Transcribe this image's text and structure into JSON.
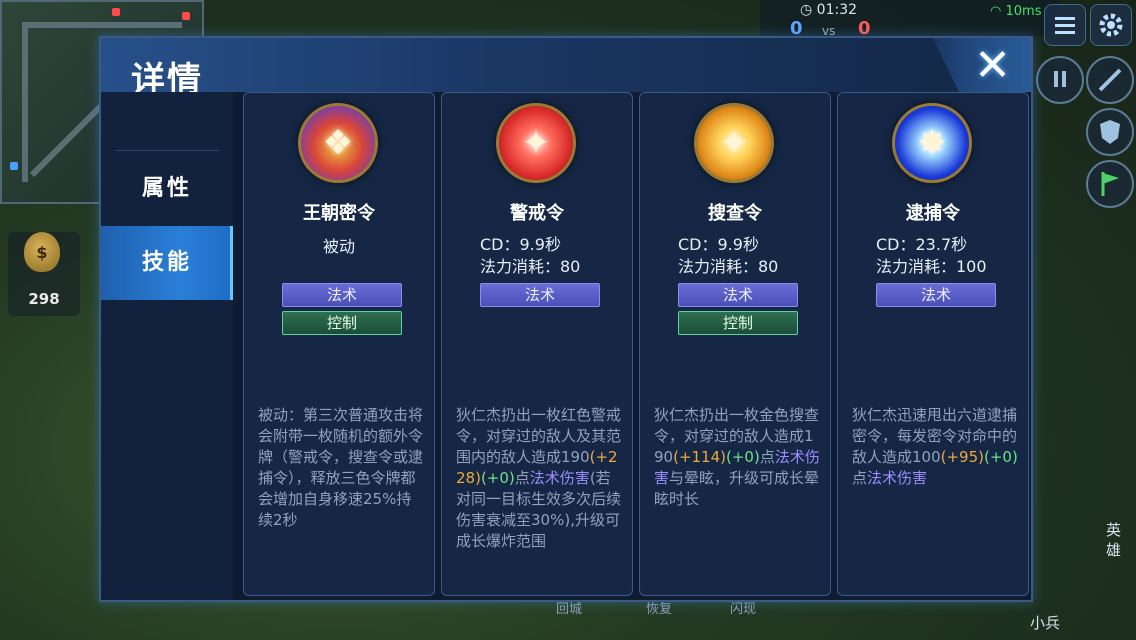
{
  "hud": {
    "timer": "01:32",
    "score_blue": "0",
    "score_vs": "vs",
    "score_red": "0",
    "ping": "10ms",
    "gold": "298",
    "gold_symbol": "$",
    "hero_button_label": "英\n雄",
    "minion_label": "小兵",
    "bottom_labels": [
      "回城",
      "恢复",
      "闪现"
    ]
  },
  "dialog": {
    "title": "详情",
    "close_symbol": "✕",
    "tabs": [
      {
        "label": "属性",
        "active": false
      },
      {
        "label": "技能",
        "active": true
      }
    ]
  },
  "skills": [
    {
      "name": "王朝密令",
      "passive_label": "被动",
      "cd": "",
      "mana": "",
      "tags": [
        "法术",
        "控制"
      ],
      "icon": "dynasty-order-icon",
      "icon_colors": [
        "#6a3fb8",
        "#d8443a",
        "#f0c23c"
      ],
      "desc_parts": [
        {
          "text": "被动：第三次普通攻击将会附带一枚随机的额外令牌（警戒令，搜查令或逮捕令），释放三色令牌都会增加自身移速25%持续2秒",
          "style": "normal"
        }
      ]
    },
    {
      "name": "警戒令",
      "passive_label": "",
      "cd": "CD：9.9秒",
      "mana": "法力消耗：80",
      "tags": [
        "法术"
      ],
      "icon": "alert-order-icon",
      "icon_colors": [
        "#d82a2a",
        "#ff6b5a"
      ],
      "desc_parts": [
        {
          "text": "狄仁杰扔出一枚红色警戒令，对穿过的敌人及其范围内的敌人造成190",
          "style": "normal"
        },
        {
          "text": "(+228)",
          "style": "orange"
        },
        {
          "text": "(+0)",
          "style": "green"
        },
        {
          "text": "点",
          "style": "normal"
        },
        {
          "text": "法术伤害",
          "style": "purple"
        },
        {
          "text": "(若对同一目标生效多次后续伤害衰减至30%),升级可成长爆炸范围",
          "style": "normal"
        }
      ]
    },
    {
      "name": "搜查令",
      "passive_label": "",
      "cd": "CD：9.9秒",
      "mana": "法力消耗：80",
      "tags": [
        "法术",
        "控制"
      ],
      "icon": "search-order-icon",
      "icon_colors": [
        "#e08a1a",
        "#ffd35a"
      ],
      "desc_parts": [
        {
          "text": "狄仁杰扔出一枚金色搜查令，对穿过的敌人造成190",
          "style": "normal"
        },
        {
          "text": "(+114)",
          "style": "orange"
        },
        {
          "text": "(+0)",
          "style": "green"
        },
        {
          "text": "点",
          "style": "normal"
        },
        {
          "text": "法术伤害",
          "style": "purple"
        },
        {
          "text": "与晕眩，升级可成长晕眩时长",
          "style": "normal"
        }
      ]
    },
    {
      "name": "逮捕令",
      "passive_label": "",
      "cd": "CD：23.7秒",
      "mana": "法力消耗：100",
      "tags": [
        "法术"
      ],
      "icon": "arrest-order-icon",
      "icon_colors": [
        "#1a3ad8",
        "#9fd8ff"
      ],
      "desc_parts": [
        {
          "text": "狄仁杰迅速甩出六道逮捕密令，每发密令对命中的敌人造成100",
          "style": "normal"
        },
        {
          "text": "(+95)",
          "style": "orange"
        },
        {
          "text": "(+0)",
          "style": "green"
        },
        {
          "text": "点",
          "style": "normal"
        },
        {
          "text": "法术伤害",
          "style": "purple"
        }
      ]
    }
  ],
  "colors": {
    "accent_blue": "#2a7fd8",
    "magic_badge": "#5a5dc8",
    "control_badge": "#2d6e52",
    "highlight_orange": "#f0a93a",
    "highlight_green": "#6fe08a",
    "highlight_purple": "#9d8cff"
  }
}
